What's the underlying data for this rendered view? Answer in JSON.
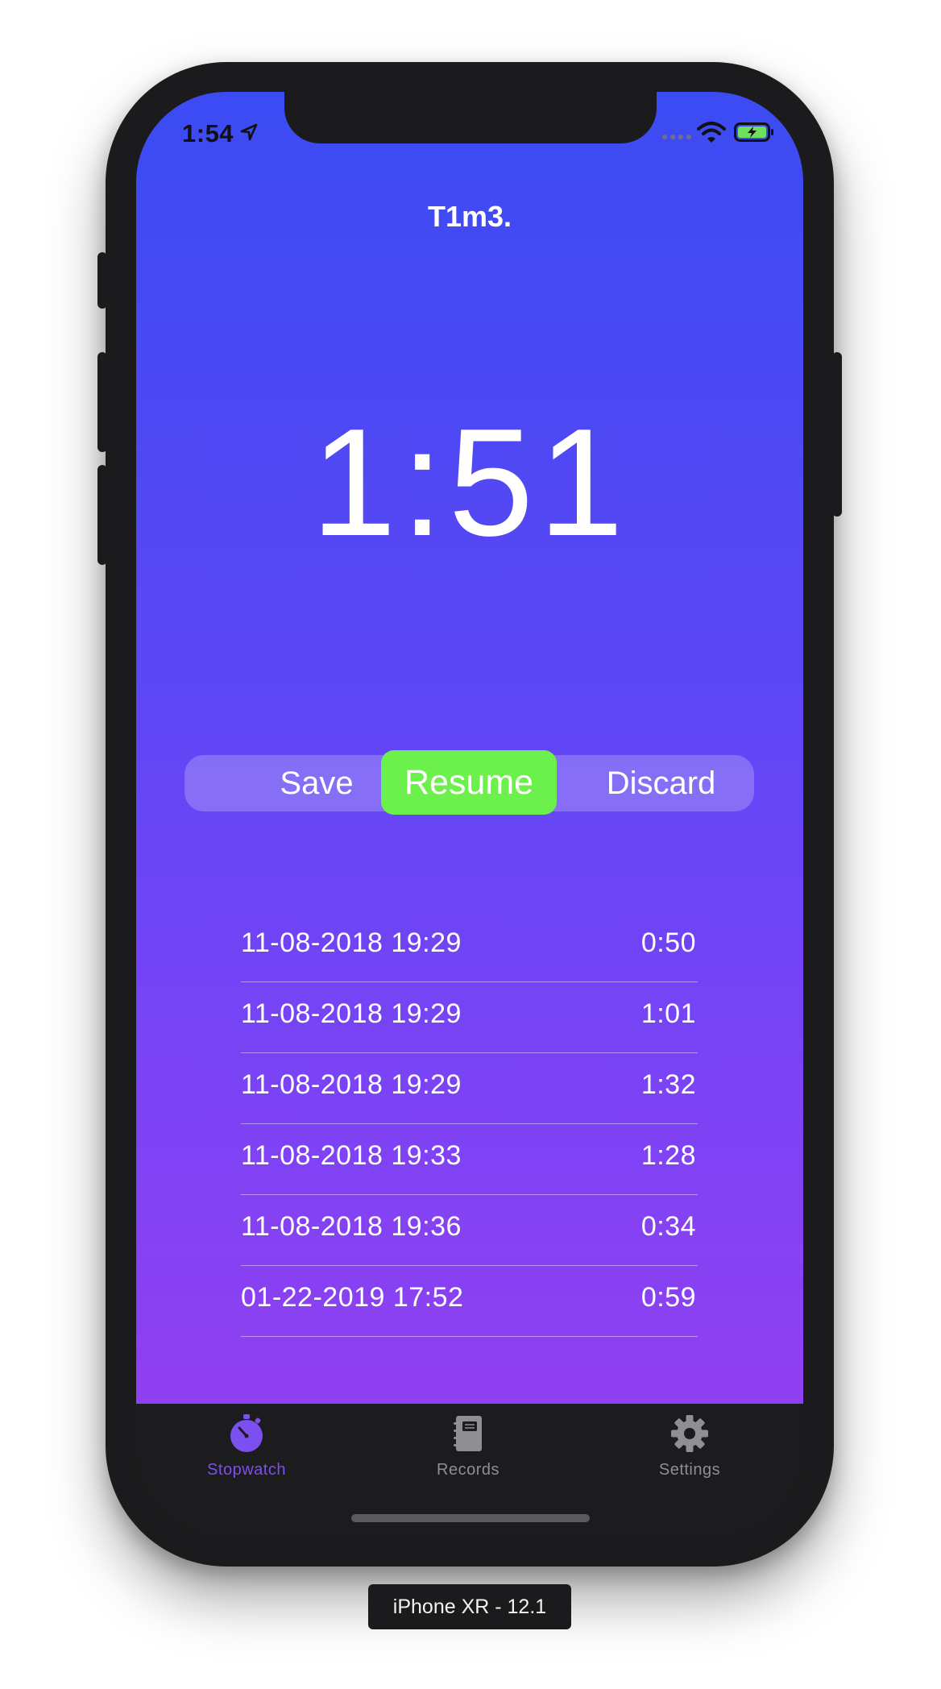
{
  "status_bar": {
    "time": "1:54"
  },
  "app": {
    "title": "T1m3."
  },
  "stopwatch": {
    "display": "1:51"
  },
  "controls": {
    "save_label": "Save",
    "resume_label": "Resume",
    "discard_label": "Discard"
  },
  "records": [
    {
      "date": "11-08-2018 19:29",
      "duration": "0:50"
    },
    {
      "date": "11-08-2018 19:29",
      "duration": "1:01"
    },
    {
      "date": "11-08-2018 19:29",
      "duration": "1:32"
    },
    {
      "date": "11-08-2018 19:33",
      "duration": "1:28"
    },
    {
      "date": "11-08-2018 19:36",
      "duration": "0:34"
    },
    {
      "date": "01-22-2019 17:52",
      "duration": "0:59"
    }
  ],
  "tabs": [
    {
      "label": "Stopwatch",
      "icon": "stopwatch-icon",
      "active": true
    },
    {
      "label": "Records",
      "icon": "notebook-icon",
      "active": false
    },
    {
      "label": "Settings",
      "icon": "gear-icon",
      "active": false
    }
  ],
  "simulator": {
    "device_label": "iPhone XR - 12.1"
  },
  "colors": {
    "gradient_top": "#3b4bf3",
    "gradient_bottom": "#9040f1",
    "resume_green": "#6cf14c",
    "tab_active": "#7b4ff0",
    "tab_inactive": "#8e8e93",
    "battery_green": "#6ee05b"
  }
}
